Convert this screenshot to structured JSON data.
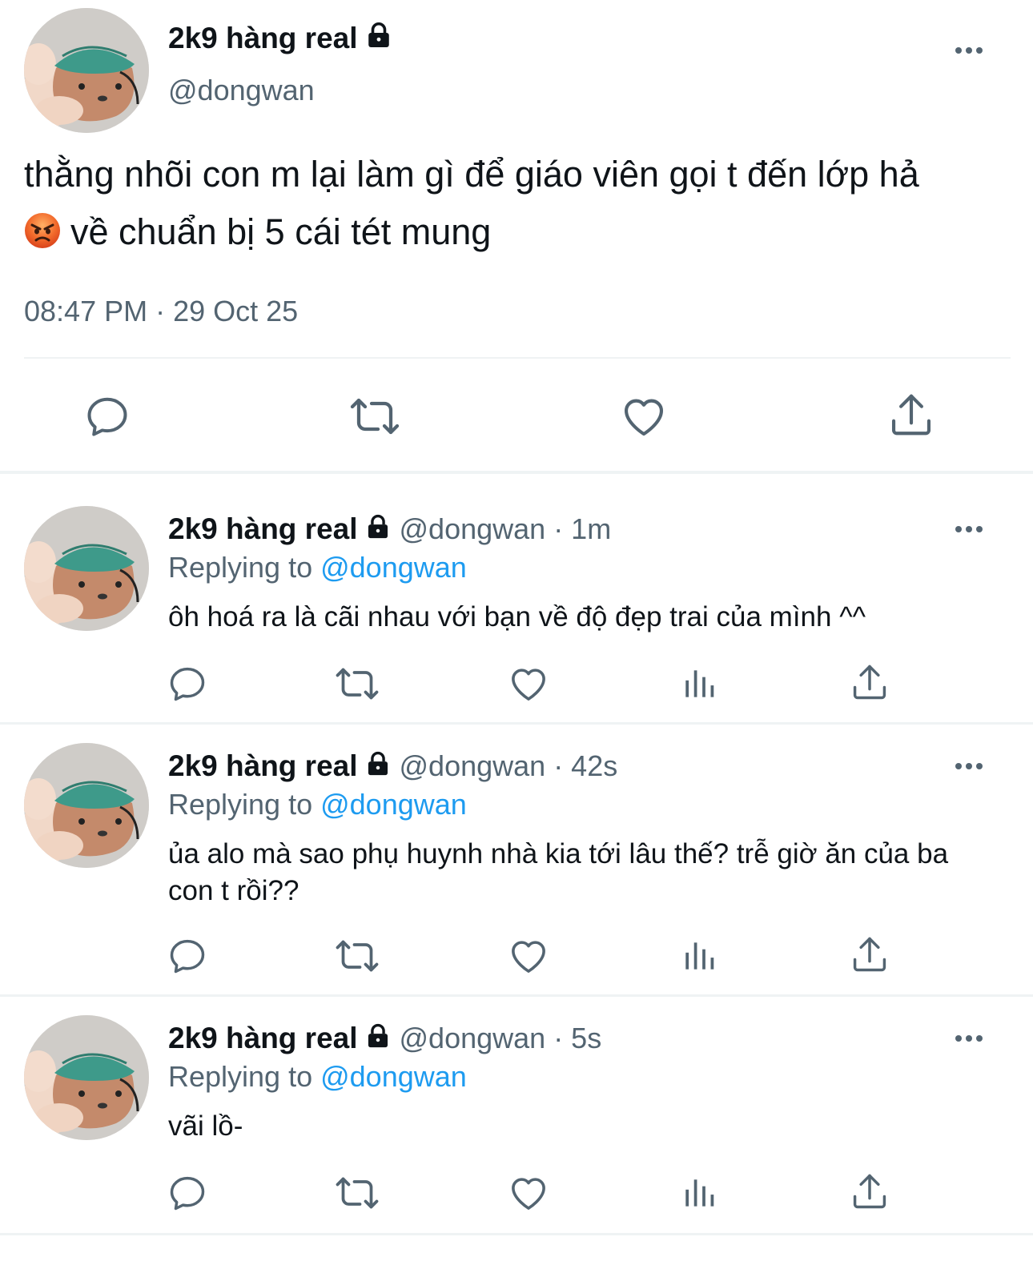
{
  "main_tweet": {
    "display_name": "2k9 hàng real",
    "handle": "@dongwan",
    "text_line1": "thằng nhõi con m lại làm gì để giáo viên gọi t đến lớp hả",
    "text_line2": "về chuẩn bị 5 cái tét mung",
    "emoji": "angry-face-emoji",
    "timestamp": "08:47 PM · 29 Oct 25"
  },
  "replies": [
    {
      "display_name": "2k9 hàng real",
      "meta": "@dongwan · 1m",
      "replying_prefix": "Replying to ",
      "replying_mention": "@dongwan",
      "text": "ôh hoá ra là cãi nhau với bạn về độ đẹp trai của mình ^^"
    },
    {
      "display_name": "2k9 hàng real",
      "meta": "@dongwan · 42s",
      "replying_prefix": "Replying to ",
      "replying_mention": "@dongwan",
      "text": "ủa alo mà sao phụ huynh nhà kia tới lâu thế? trễ giờ ăn của ba con t rồi??"
    },
    {
      "display_name": "2k9 hàng real",
      "meta": "@dongwan · 5s",
      "replying_prefix": "Replying to ",
      "replying_mention": "@dongwan",
      "text": "vãi lồ-"
    }
  ],
  "icons": {
    "lock": "lock-icon",
    "more": "more-icon",
    "reply": "reply-icon",
    "retweet": "retweet-icon",
    "like": "heart-icon",
    "views": "views-icon",
    "share": "share-icon"
  },
  "colors": {
    "text": "#0f1419",
    "secondary": "#536471",
    "link": "#1d9bf0",
    "divider": "#eff3f4"
  }
}
